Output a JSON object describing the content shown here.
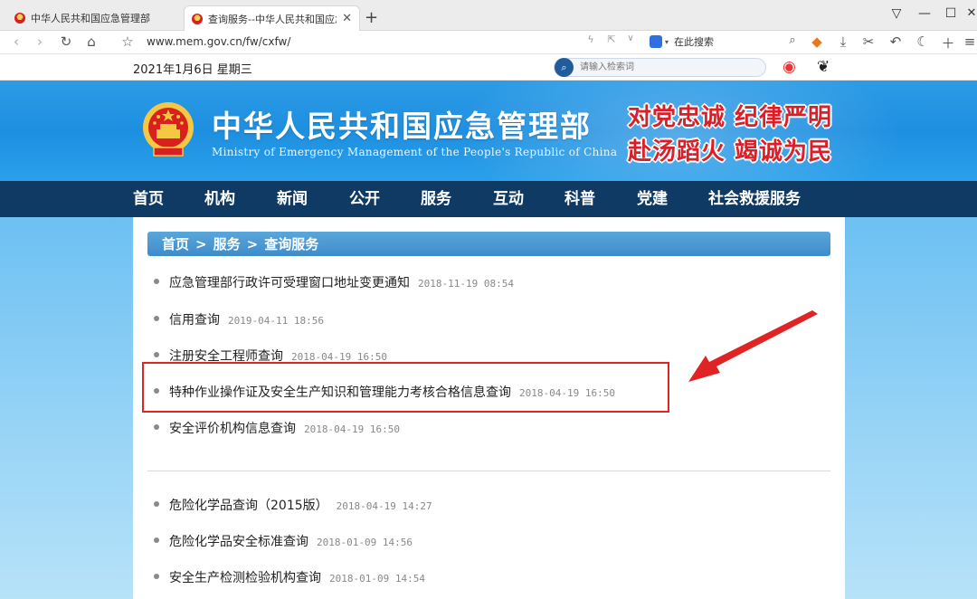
{
  "browser": {
    "tabs": [
      {
        "title": "中华人民共和国应急管理部",
        "active": false
      },
      {
        "title": "查询服务--中华人民共和国应急管理部",
        "active": true
      }
    ],
    "new_tab": "+",
    "window_buttons": [
      "▽",
      "—",
      "☐",
      "✕"
    ],
    "url": "www.mem.gov.cn/fw/cxfw/",
    "search_engine_label": "在此搜索",
    "icons": [
      "back-icon",
      "forward-icon",
      "reload-icon",
      "home-icon",
      "star-icon",
      "lightning-icon",
      "share-icon",
      "game-icon",
      "download-icon",
      "scissors-icon",
      "undo-icon",
      "night-mode-icon",
      "add-icon",
      "menu-icon"
    ]
  },
  "header": {
    "date": "2021年1月6日  星期三",
    "search_placeholder": "请输入检索词",
    "title_cn": "中华人民共和国应急管理部",
    "title_en": "Ministry of Emergency Management of the People's Republic of China",
    "slogan_line1": "对党忠诚  纪律严明",
    "slogan_line2": "赴汤蹈火  竭诚为民",
    "accent_color": "#1e8fe0",
    "nav_color": "#0f3a63"
  },
  "nav": {
    "items": [
      "首页",
      "机构",
      "新闻",
      "公开",
      "服务",
      "互动",
      "科普",
      "党建",
      "社会救援服务"
    ]
  },
  "breadcrumb": {
    "home": "首页",
    "sep1": ">",
    "section": "服务",
    "sep2": ">",
    "current": "查询服务"
  },
  "list": {
    "group1": [
      {
        "text": "应急管理部行政许可受理窗口地址变更通知",
        "time": "2018-11-19 08:54"
      },
      {
        "text": "信用查询",
        "time": "2019-04-11 18:56"
      },
      {
        "text": "注册安全工程师查询",
        "time": "2018-04-19 16:50"
      },
      {
        "text": "特种作业操作证及安全生产知识和管理能力考核合格信息查询",
        "time": "2018-04-19 16:50"
      },
      {
        "text": "安全评价机构信息查询",
        "time": "2018-04-19 16:50"
      }
    ],
    "group2": [
      {
        "text": "危险化学品查询（2015版）",
        "time": "2018-04-19 14:27"
      },
      {
        "text": "危险化学品安全标准查询",
        "time": "2018-01-09 14:56"
      },
      {
        "text": "安全生产检测检验机构查询",
        "time": "2018-01-09 14:54"
      }
    ]
  },
  "annotation_color": "#e02424"
}
